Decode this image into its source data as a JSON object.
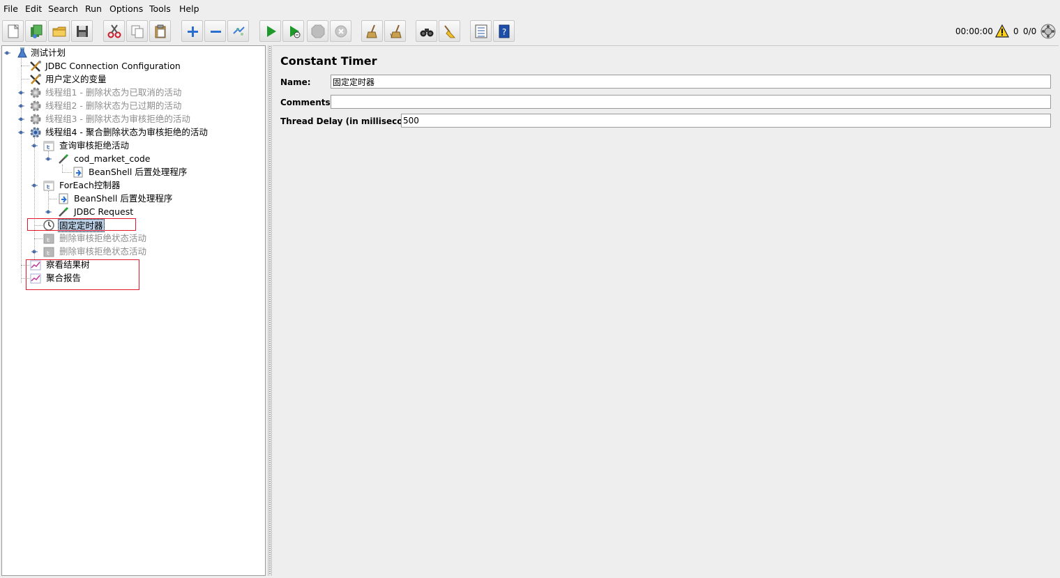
{
  "menu": {
    "items": [
      {
        "label": "File"
      },
      {
        "label": "Edit"
      },
      {
        "label": "Search"
      },
      {
        "label": "Run"
      },
      {
        "label": "Options"
      },
      {
        "label": "Tools"
      },
      {
        "label": "Help"
      }
    ]
  },
  "toolbar": {
    "buttons": [
      {
        "icon": "new-file-icon"
      },
      {
        "icon": "templates-icon"
      },
      {
        "icon": "open-folder-icon"
      },
      {
        "icon": "save-icon"
      },
      {
        "icon": "cut-icon"
      },
      {
        "icon": "copy-icon"
      },
      {
        "icon": "paste-icon"
      },
      {
        "icon": "expand-icon"
      },
      {
        "icon": "collapse-icon"
      },
      {
        "icon": "toggle-icon"
      },
      {
        "icon": "start-icon"
      },
      {
        "icon": "start-no-pauses-icon"
      },
      {
        "icon": "stop-icon"
      },
      {
        "icon": "shutdown-icon"
      },
      {
        "icon": "clear-icon"
      },
      {
        "icon": "clear-all-icon"
      },
      {
        "icon": "search-binoculars-icon"
      },
      {
        "icon": "reset-search-icon"
      },
      {
        "icon": "function-helper-icon"
      },
      {
        "icon": "help-icon"
      }
    ]
  },
  "status": {
    "timer": "00:00:00",
    "warnings": "0",
    "threads": "0/0"
  },
  "tree": {
    "nodes": [
      {
        "label": "测试计划",
        "icon": "test-plan-flask-icon",
        "disabled": false
      },
      {
        "label": "JDBC Connection Configuration",
        "icon": "config-tools-icon",
        "disabled": false
      },
      {
        "label": "用户定义的变量",
        "icon": "config-tools-icon",
        "disabled": false
      },
      {
        "label": "线程组1 - 删除状态为已取消的活动",
        "icon": "thread-group-gear-icon",
        "disabled": true
      },
      {
        "label": "线程组2 - 删除状态为已过期的活动",
        "icon": "thread-group-gear-icon",
        "disabled": true
      },
      {
        "label": "线程组3 - 删除状态为审核拒绝的活动",
        "icon": "thread-group-gear-icon",
        "disabled": true
      },
      {
        "label": "线程组4 - 聚合删除状态为审核拒绝的活动",
        "icon": "thread-group-gear-icon",
        "disabled": false
      },
      {
        "label": "查询审核拒绝活动",
        "icon": "controller-icon",
        "disabled": false
      },
      {
        "label": "cod_market_code",
        "icon": "jdbc-sampler-pipette-icon",
        "disabled": false
      },
      {
        "label": "BeanShell 后置处理程序",
        "icon": "post-processor-icon",
        "disabled": false
      },
      {
        "label": "ForEach控制器",
        "icon": "controller-icon",
        "disabled": false
      },
      {
        "label": "BeanShell 后置处理程序",
        "icon": "post-processor-icon",
        "disabled": false
      },
      {
        "label": "JDBC Request",
        "icon": "jdbc-sampler-pipette-icon",
        "disabled": false
      },
      {
        "label": "固定定时器",
        "icon": "timer-clock-icon",
        "disabled": false,
        "selected": true
      },
      {
        "label": "删除审核拒绝状态活动",
        "icon": "controller-icon",
        "disabled": true
      },
      {
        "label": "删除审核拒绝状态活动",
        "icon": "controller-icon",
        "disabled": true
      },
      {
        "label": "察看结果树",
        "icon": "listener-graph-icon",
        "disabled": false
      },
      {
        "label": "聚合报告",
        "icon": "listener-graph-icon",
        "disabled": false
      }
    ]
  },
  "panel": {
    "title": "Constant Timer",
    "name_label": "Name:",
    "name_value": "固定定时器",
    "comments_label": "Comments:",
    "comments_value": "",
    "delay_label": "Thread Delay (in milliseconds):",
    "delay_value": "500"
  },
  "colors": {
    "highlight_box": "#e0182a",
    "selection": "#b8cfe5",
    "disabled_text": "#8d8d8d"
  }
}
